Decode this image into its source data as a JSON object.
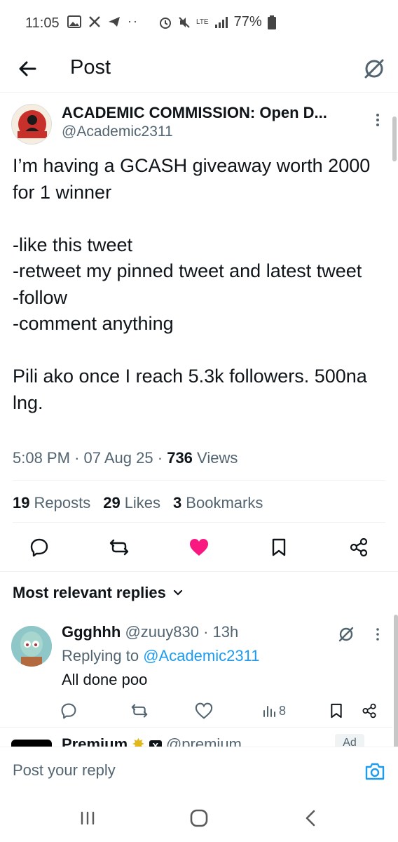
{
  "status_bar": {
    "time": "11:05",
    "network": "LTE",
    "battery": "77%"
  },
  "header": {
    "title": "Post"
  },
  "post": {
    "author_name": "ACADEMIC COMMISSION: Open D...",
    "author_handle": "@Academic2311",
    "avatar_caption": "ACADEMIC COMMISSION",
    "text": "I’m having a GCASH giveaway worth 2000 for 1 winner\n\n-like this tweet\n-retweet my pinned tweet and latest tweet\n-follow\n-comment anything\n\nPili ako once I reach 5.3k followers. 500na lng.",
    "time": "5:08 PM",
    "date": "07 Aug 25",
    "views_count": "736",
    "views_label": "Views",
    "reposts_count": "19",
    "reposts_label": "Reposts",
    "likes_count": "29",
    "likes_label": "Likes",
    "bookmarks_count": "3",
    "bookmarks_label": "Bookmarks",
    "liked": true,
    "like_color": "#f91880"
  },
  "replies_section": {
    "sort_label": "Most relevant replies"
  },
  "reply": {
    "name": "Ggghhh",
    "handle": "@zuuy830",
    "age": "13h",
    "replying_prefix": "Replying to",
    "replying_to": "@Academic2311",
    "text": "All done poo",
    "views": "8"
  },
  "ad_peek": {
    "name": "Premium",
    "handle": "@premium",
    "ad_badge": "Ad"
  },
  "composer": {
    "placeholder": "Post your reply"
  },
  "colors": {
    "accent": "#1d9bf0",
    "secondary_text": "#536471",
    "primary_text": "#0f1419"
  }
}
